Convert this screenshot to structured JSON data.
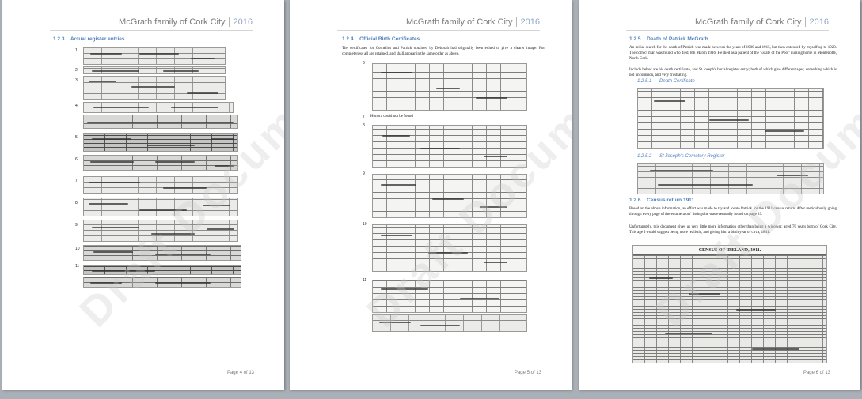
{
  "document": {
    "header_title": "McGrath family of Cork City",
    "header_year": "2016",
    "watermark": "Draft Document"
  },
  "pages": [
    {
      "page_label": "Page 4 of 13",
      "section_heading": {
        "number": "1.2.3.",
        "title": "Actual register entries"
      },
      "entry_numbers": [
        "1",
        "2",
        "3",
        "4",
        "5",
        "6",
        "7",
        "8",
        "9",
        "10",
        "11"
      ]
    },
    {
      "page_label": "Page 5 of 13",
      "section_heading": {
        "number": "1.2.4.",
        "title": "Official Birth Certificates"
      },
      "intro_text": "The certificates for Cornelius and Patrick obtained by Deborah had originally been edited to give a clearer image. For completeness all are retained, and shall appear in the same order as above.",
      "entry_numbers": [
        "6",
        "7",
        "8",
        "9",
        "10",
        "11"
      ],
      "not_found_text": "Honora could not be found"
    },
    {
      "page_label": "Page 6 of 13",
      "section_heading": {
        "number": "1.2.5.",
        "title": "Death of Patrick McGrath"
      },
      "para_1": "An initial search for the death of Patrick was made between the years of 1900 and 1915, but then extended by myself up to 1920. The correct man was found who died, 8th March 1916. He died as a patient of the 'Estate of the Poor' nursing home in Montenotte, North Cork.",
      "para_2": "Include below are his death certificate, and St Joseph's burial register entry; both of which give different ages; something which is not uncommon, and very frustrating.",
      "sub_1": {
        "number": "1.2.5.1",
        "title": "Death Certificate"
      },
      "sub_2": {
        "number": "1.2.5.2",
        "title": "St Joseph's Cemetery Register"
      },
      "section_heading_2": {
        "number": "1.2.6.",
        "title": "Census return 1911"
      },
      "para_3": "Based on the above information, an effort was made to try and locate Patrick for the 1911 census return. After meticulously going through every page of the enumerators' listings he was eventually found on page 29.",
      "para_4": "Unfortunately, this document gives us very little more information other than being a widower, aged 70 years born of Cork City. This age I would suggest being more realistic, and giving him a birth year of circa, 1841.",
      "census_title": "CENSUS OF IRELAND, 1911."
    }
  ]
}
